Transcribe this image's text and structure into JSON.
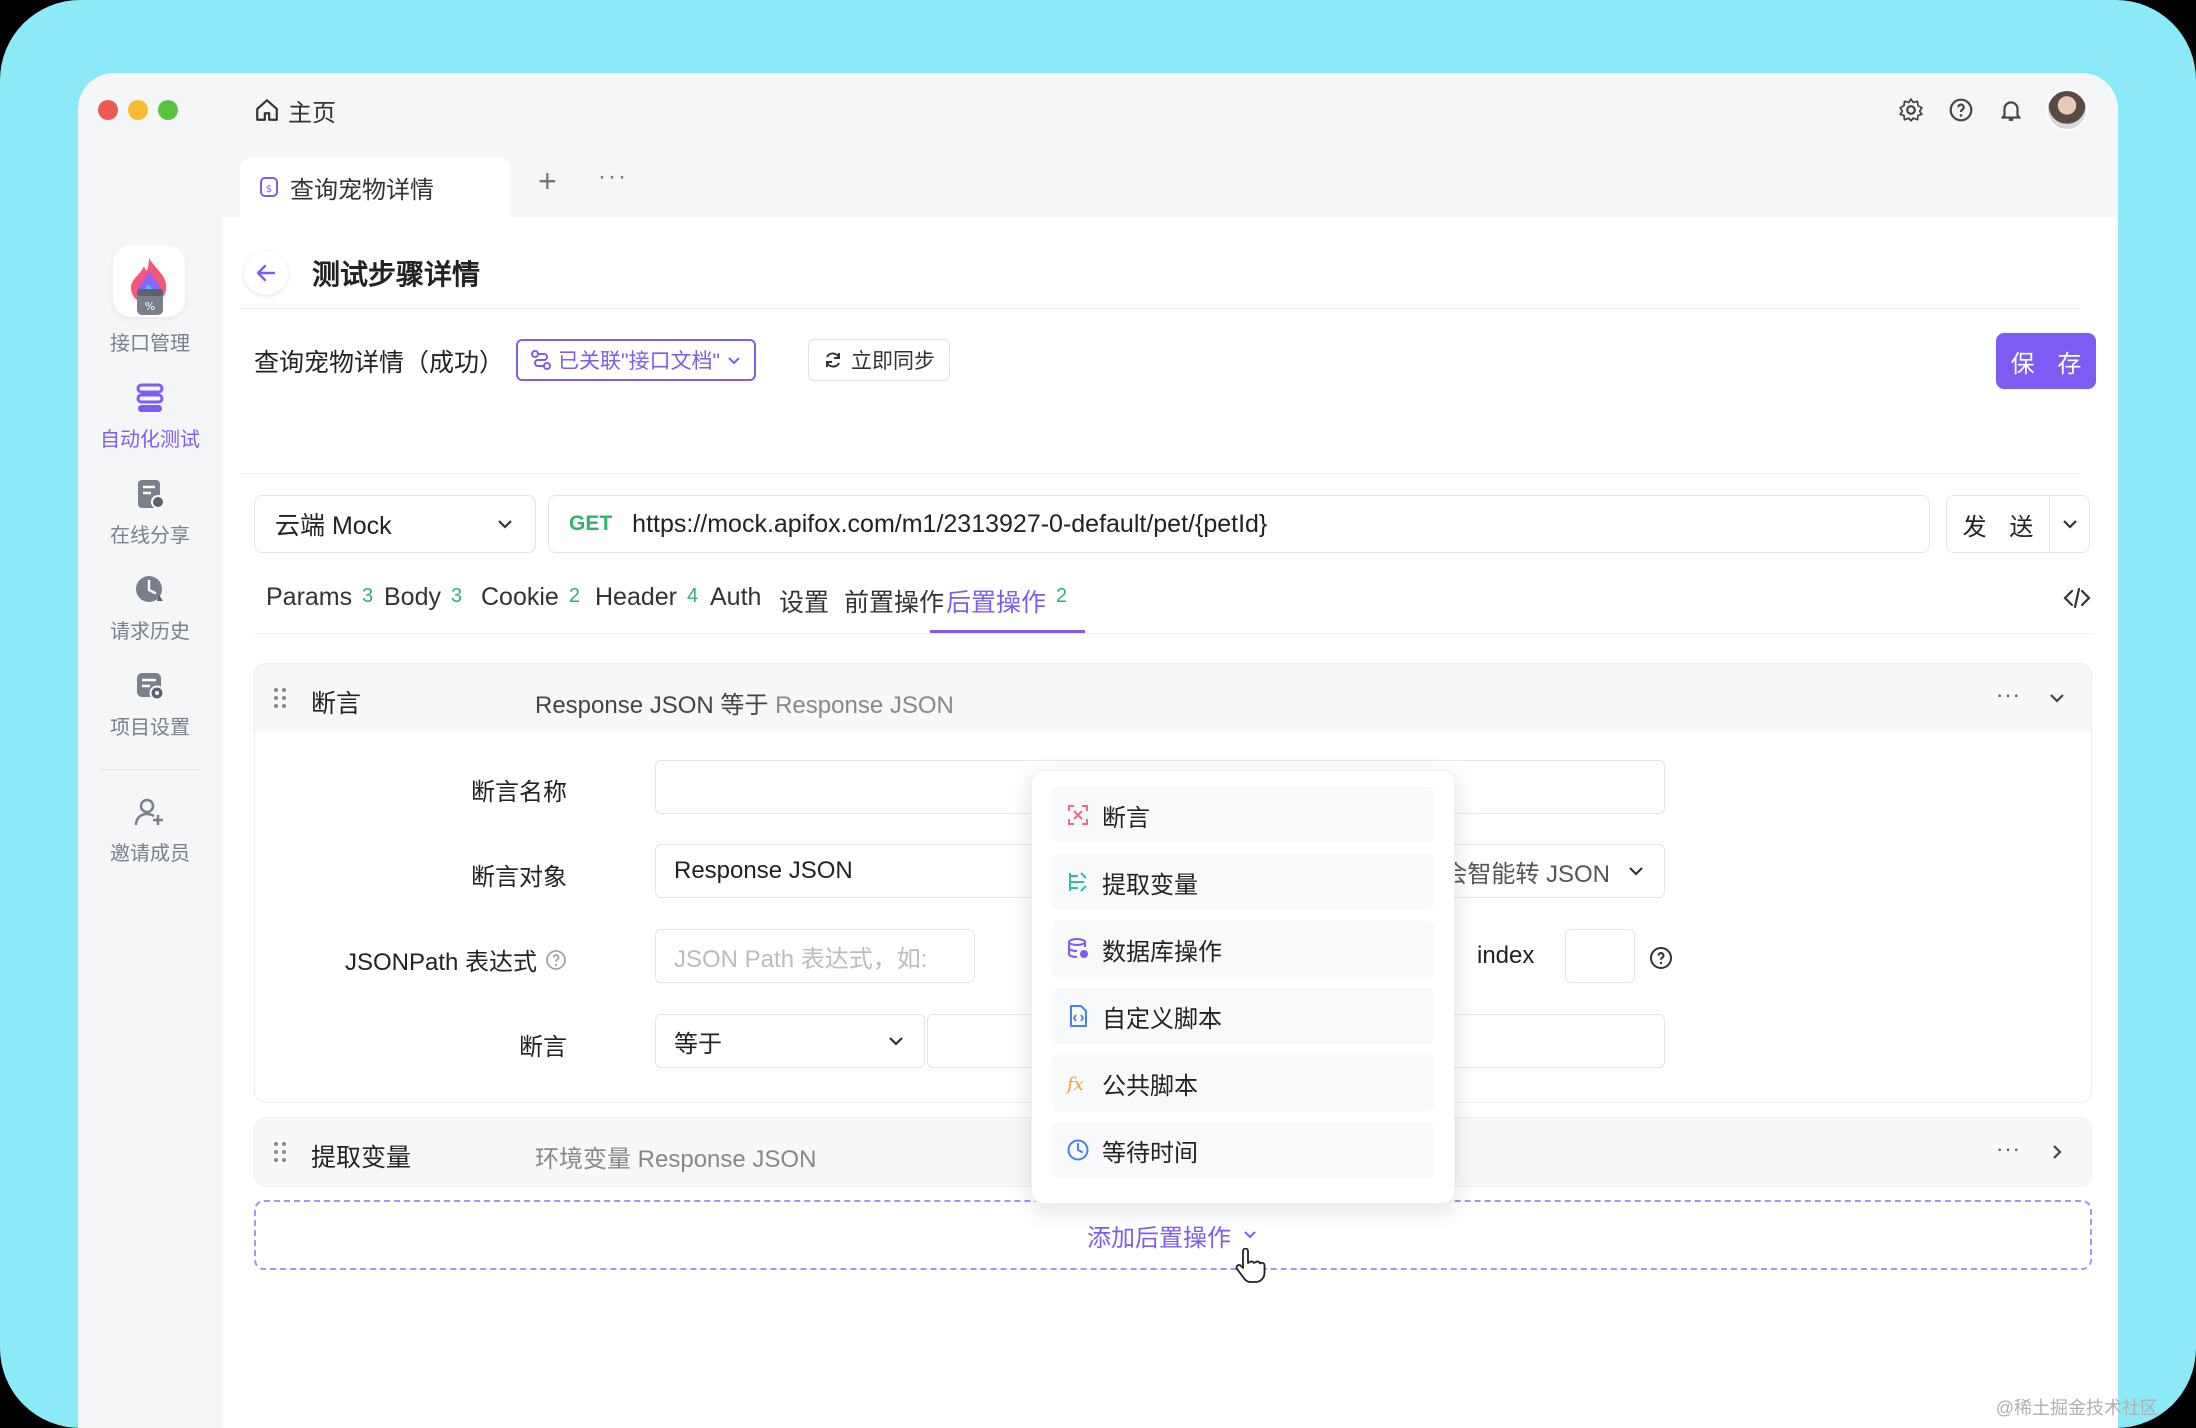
{
  "titlebar": {
    "home_label": "主页"
  },
  "sidebar": {
    "items": [
      {
        "label": "接口管理"
      },
      {
        "label": "自动化测试"
      },
      {
        "label": "在线分享"
      },
      {
        "label": "请求历史"
      },
      {
        "label": "项目设置"
      },
      {
        "label": "邀请成员"
      }
    ]
  },
  "tabs": {
    "active_file": "查询宠物详情",
    "add": "+",
    "more": "···"
  },
  "header": {
    "title": "测试步骤详情"
  },
  "case": {
    "name": "查询宠物详情（成功）",
    "linked_label": "已关联\"接口文档\"",
    "sync_label": "立即同步",
    "save_label": "保 存"
  },
  "request": {
    "env": "云端 Mock",
    "method": "GET",
    "url": "https://mock.apifox.com/m1/2313927-0-default/pet/{petId}",
    "send_label": "发 送"
  },
  "request_tabs": [
    {
      "label": "Params",
      "count": "3"
    },
    {
      "label": "Body",
      "count": "3"
    },
    {
      "label": "Cookie",
      "count": "2"
    },
    {
      "label": "Header",
      "count": "4"
    },
    {
      "label": "Auth",
      "count": ""
    },
    {
      "label": "设置",
      "count": ""
    },
    {
      "label": "前置操作",
      "count": ""
    },
    {
      "label": "后置操作",
      "count": "2"
    }
  ],
  "assertion_card": {
    "title": "断言",
    "summary_main": "Response JSON 等于",
    "summary_muted": "Response JSON",
    "fields": {
      "name_label": "断言名称",
      "name_value": "",
      "target_label": "断言对象",
      "target_value": "Response JSON",
      "target_hint": ") 会智能转 JSON",
      "jsonpath_label": "JSONPath 表达式",
      "jsonpath_placeholder": "JSON Path 表达式，如:",
      "index_label": "index",
      "assert_label": "断言",
      "assert_op": "等于"
    }
  },
  "extract_card": {
    "title": "提取变量",
    "summary_muted": "环境变量 Response JSON"
  },
  "add_post_op_label": "添加后置操作",
  "dropdown": {
    "items": [
      {
        "label": "断言",
        "icon": "assert-icon",
        "color": "#f06a8a"
      },
      {
        "label": "提取变量",
        "icon": "extract-icon",
        "color": "#2bbfa8"
      },
      {
        "label": "数据库操作",
        "icon": "database-icon",
        "color": "#7d5cf3"
      },
      {
        "label": "自定义脚本",
        "icon": "script-icon",
        "color": "#4a7ef5"
      },
      {
        "label": "公共脚本",
        "icon": "function-icon",
        "color": "#f0a51a"
      },
      {
        "label": "等待时间",
        "icon": "clock-icon",
        "color": "#4a7ef5"
      }
    ]
  },
  "watermark": "@稀土掘金技术社区",
  "colors": {
    "accent": "#7d5cf3",
    "success": "#2fb36b",
    "frame": "#8ce9f8"
  }
}
